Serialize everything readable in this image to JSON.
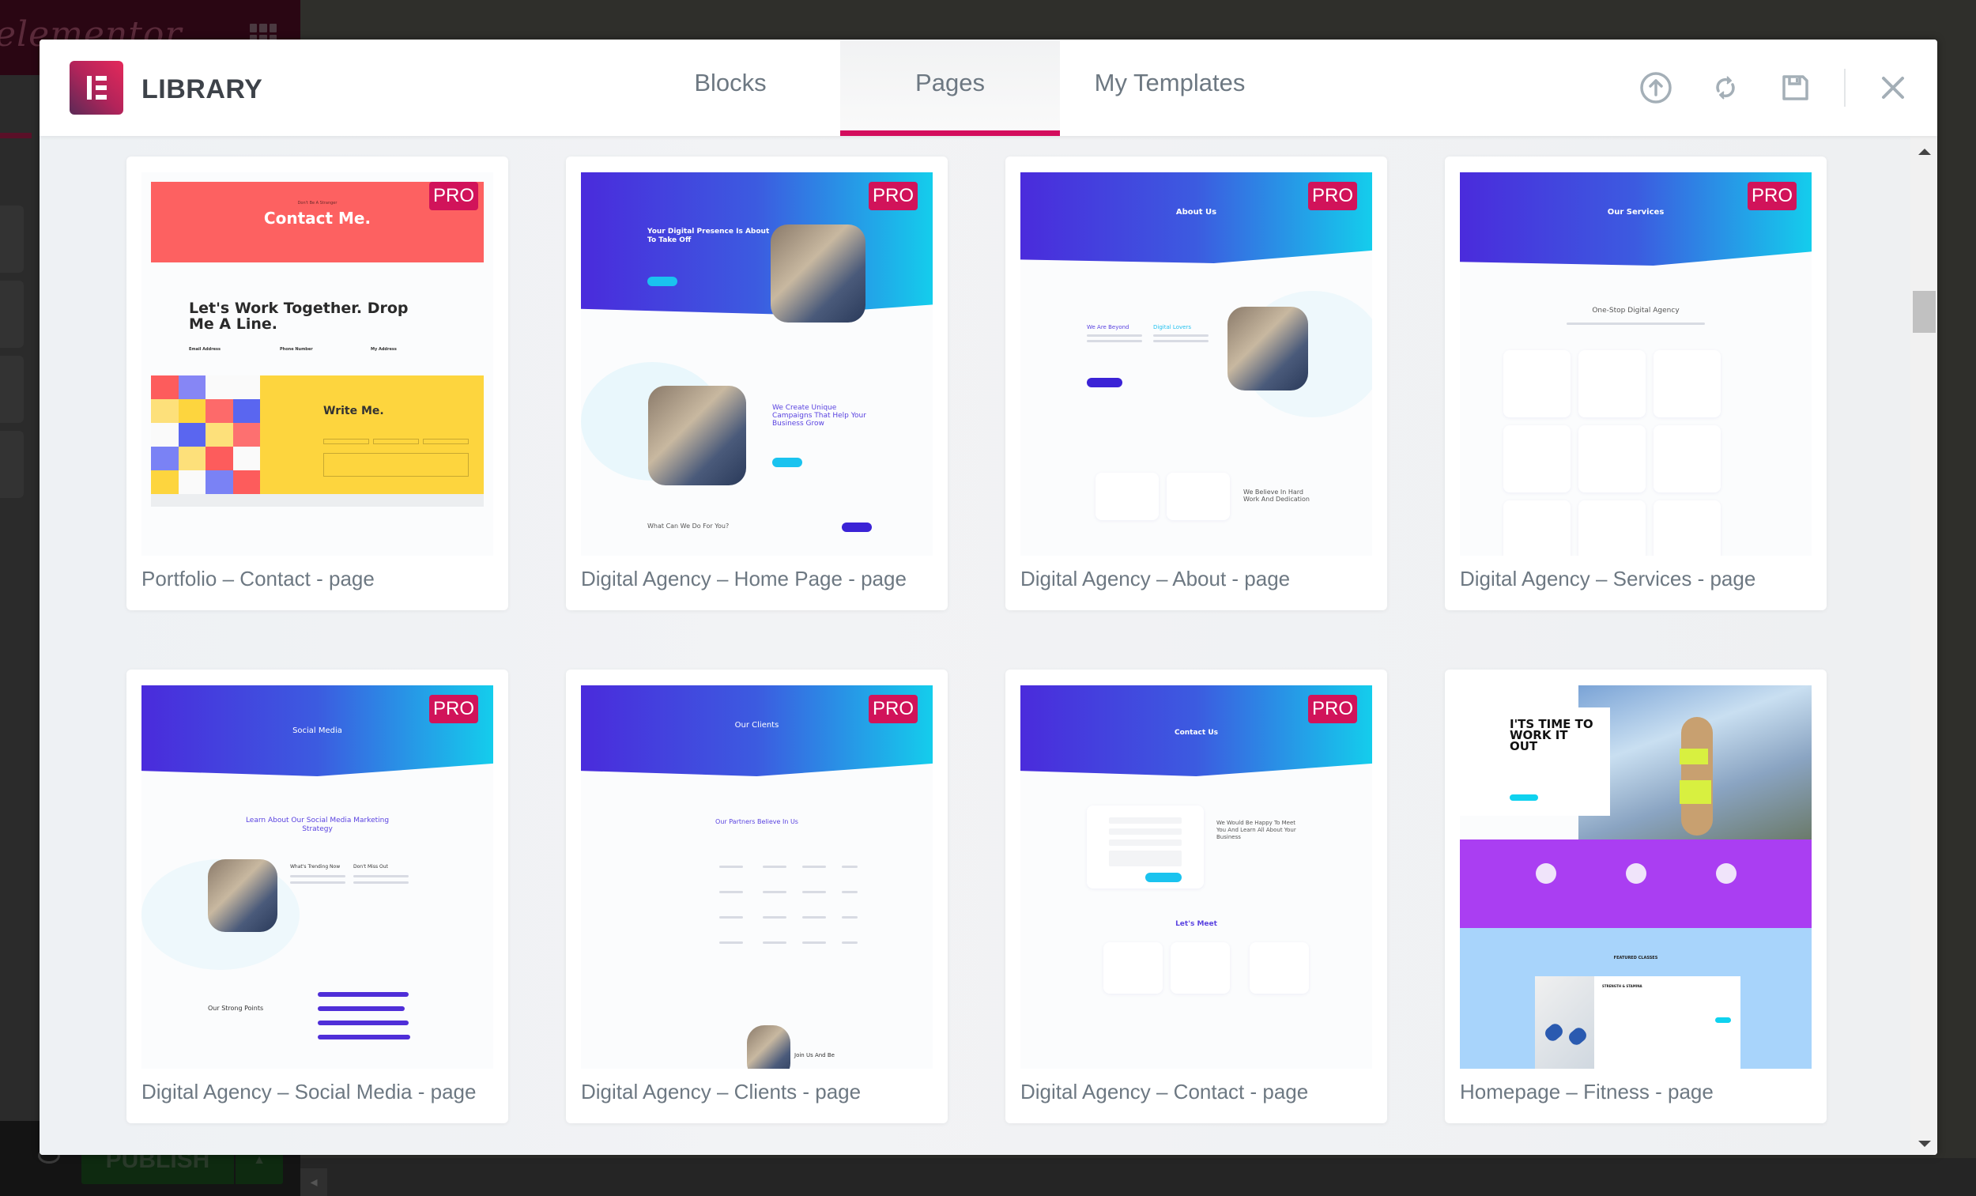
{
  "background": {
    "editor_logo": "elementor",
    "publish_label": "PUBLISH"
  },
  "header": {
    "title": "LIBRARY",
    "tabs": [
      {
        "label": "Blocks",
        "active": false
      },
      {
        "label": "Pages",
        "active": true
      },
      {
        "label": "My Templates",
        "active": false
      }
    ],
    "actions": {
      "import_icon": "upload-circle-icon",
      "sync_icon": "sync-icon",
      "save_icon": "floppy-disk-icon",
      "close_icon": "close-icon"
    },
    "accent_color": "#d30c5c"
  },
  "templates": [
    {
      "label": "Portfolio – Contact - page",
      "badge": "PRO",
      "preview": {
        "kicker": "Don't Be A Stranger",
        "heading": "Contact Me.",
        "subheading": "Let's Work Together. Drop Me A Line.",
        "fields": [
          "Email Address",
          "Phone Number",
          "My Address"
        ],
        "form_heading": "Write Me."
      }
    },
    {
      "label": "Digital Agency – Home Page - page",
      "badge": "PRO",
      "preview": {
        "heading": "Your Digital Presence Is About To Take Off",
        "section_heading": "We Create Unique Campaigns That Help Your Business Grow",
        "footer_heading": "What Can We Do For You?"
      }
    },
    {
      "label": "Digital Agency – About - page",
      "badge": "PRO",
      "preview": {
        "heading": "About Us",
        "col1": "We Are Beyond",
        "col2": "Digital Lovers",
        "footer_heading": "We Believe In Hard Work And Dedication"
      }
    },
    {
      "label": "Digital Agency – Services - page",
      "badge": "PRO",
      "preview": {
        "heading": "Our Services",
        "section_heading": "One-Stop Digital Agency"
      }
    },
    {
      "label": "Digital Agency – Social Media - page",
      "badge": "PRO",
      "preview": {
        "heading": "Social Media",
        "section_heading": "Learn About Our Social Media Marketing Strategy",
        "col1": "What's Trending Now",
        "col2": "Don't Miss Out",
        "footer_heading": "Our Strong Points"
      }
    },
    {
      "label": "Digital Agency – Clients - page",
      "badge": "PRO",
      "preview": {
        "heading": "Our Clients",
        "section_heading": "Our Partners Believe In Us",
        "footer_heading": "Join Us And Be"
      }
    },
    {
      "label": "Digital Agency – Contact - page",
      "badge": "PRO",
      "preview": {
        "heading": "Contact Us",
        "section_heading": "We Would Be Happy To Meet You And Learn All About Your Business",
        "footer_heading": "Let's Meet"
      }
    },
    {
      "label": "Homepage – Fitness - page",
      "badge": "",
      "preview": {
        "heading": "I'TS TIME TO WORK IT OUT",
        "section_heading": "FEATURED CLASSES",
        "class_title": "STRENGTH & STAMINA"
      }
    }
  ]
}
